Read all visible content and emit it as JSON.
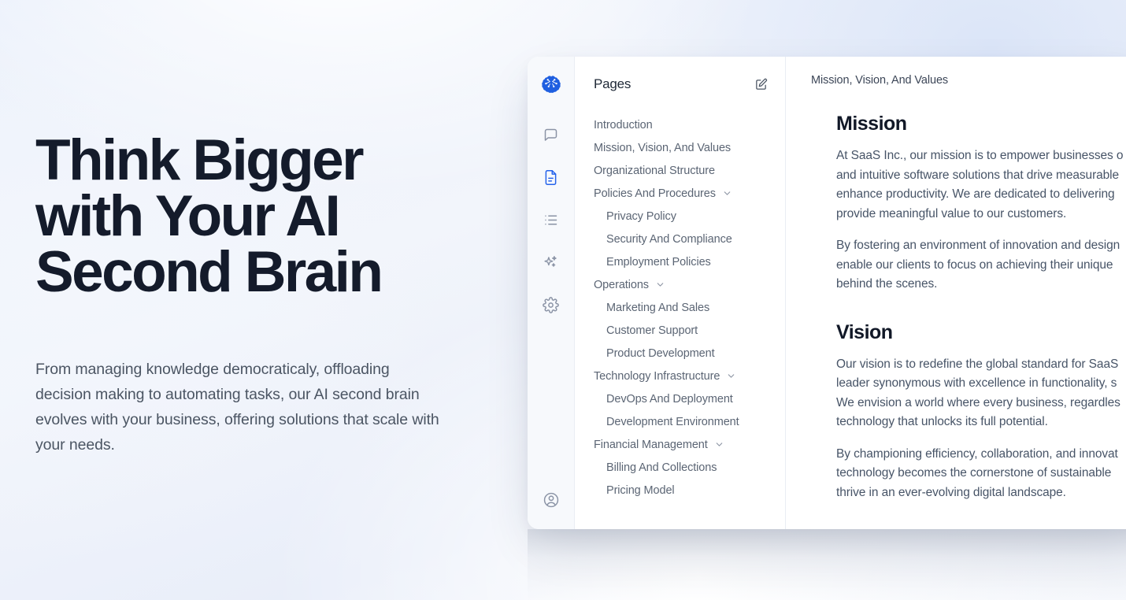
{
  "hero": {
    "title": "Think Bigger\nwith Your AI\nSecond Brain",
    "subtitle": "From managing knowledge democraticaly, offloading decision making to automating tasks, our AI second brain evolves with your business, offering solutions that scale with your needs."
  },
  "colors": {
    "accent": "#2563eb",
    "logo": "#1f5fe0",
    "heading": "#111827",
    "body": "#475467",
    "nav_text": "#5b6574",
    "rail_bg": "#f7f9fc"
  },
  "rail": {
    "logo_icon": "brain-icon",
    "items": [
      {
        "icon": "chat-bubble-icon",
        "name": "chat",
        "active": false
      },
      {
        "icon": "document-icon",
        "name": "documents",
        "active": true
      },
      {
        "icon": "list-icon",
        "name": "list",
        "active": false
      },
      {
        "icon": "sparkles-icon",
        "name": "ai-assist",
        "active": false
      },
      {
        "icon": "gear-icon",
        "name": "settings",
        "active": false
      }
    ],
    "avatar_icon": "user-circle-icon"
  },
  "pages_panel": {
    "title": "Pages",
    "edit_icon": "edit-square-pencil-icon",
    "nav": [
      {
        "label": "Introduction",
        "level": 0,
        "expandable": false
      },
      {
        "label": "Mission, Vision, And Values",
        "level": 0,
        "expandable": false
      },
      {
        "label": "Organizational Structure",
        "level": 0,
        "expandable": false
      },
      {
        "label": "Policies And Procedures",
        "level": 0,
        "expandable": true
      },
      {
        "label": "Privacy Policy",
        "level": 1,
        "expandable": false
      },
      {
        "label": "Security And Compliance",
        "level": 1,
        "expandable": false
      },
      {
        "label": "Employment Policies",
        "level": 1,
        "expandable": false
      },
      {
        "label": "Operations",
        "level": 0,
        "expandable": true
      },
      {
        "label": "Marketing And Sales",
        "level": 1,
        "expandable": false
      },
      {
        "label": "Customer Support",
        "level": 1,
        "expandable": false
      },
      {
        "label": "Product Development",
        "level": 1,
        "expandable": false
      },
      {
        "label": "Technology Infrastructure",
        "level": 0,
        "expandable": true
      },
      {
        "label": "DevOps And Deployment",
        "level": 1,
        "expandable": false
      },
      {
        "label": "Development Environment",
        "level": 1,
        "expandable": false
      },
      {
        "label": "Financial Management",
        "level": 0,
        "expandable": true
      },
      {
        "label": "Billing And Collections",
        "level": 1,
        "expandable": false
      },
      {
        "label": "Pricing Model",
        "level": 1,
        "expandable": false
      }
    ]
  },
  "document": {
    "breadcrumb": "Mission, Vision, And Values",
    "sections": [
      {
        "heading": "Mission",
        "paragraphs": [
          "At SaaS Inc., our mission is to empower businesses o",
          "By fostering an environment of innovation and design"
        ],
        "paragraph_lines": [
          [
            "At SaaS Inc., our mission is to empower businesses o",
            "and intuitive software solutions that drive measurable",
            "enhance productivity. We are dedicated to delivering",
            "provide meaningful value to our customers."
          ],
          [
            "By fostering an environment of innovation and design",
            "enable our clients to focus on achieving their unique",
            "behind the scenes."
          ]
        ]
      },
      {
        "heading": "Vision",
        "paragraph_lines": [
          [
            "Our vision is to redefine the global standard for SaaS",
            "leader synonymous with excellence in functionality, s",
            "We envision a world where every business, regardles",
            "technology that unlocks its full potential."
          ],
          [
            "By championing efficiency, collaboration, and innovat",
            "technology becomes the cornerstone of sustainable",
            "thrive in an ever-evolving digital landscape."
          ]
        ]
      }
    ]
  }
}
